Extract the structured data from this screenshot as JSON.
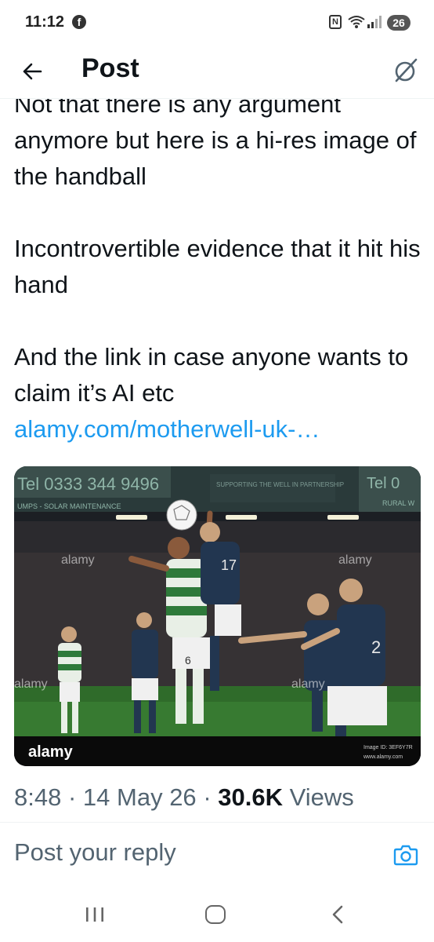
{
  "status_bar": {
    "time": "11:12",
    "fb_icon_letter": "f",
    "nfc_letter": "N",
    "battery": "26",
    "icons": [
      "facebook-icon",
      "nfc-icon",
      "wifi-icon",
      "signal-icon",
      "battery-icon"
    ]
  },
  "header": {
    "title": "Post",
    "back_icon": "arrow-left-icon",
    "grok_icon": "grok-icon"
  },
  "tweet": {
    "lines": [
      "Not that there is any argument anymore but here is a hi-res image of the handball",
      "Incontrovertible evidence that it hit his hand",
      "And the link in case anyone wants to claim it’s AI etc"
    ],
    "link": "alamy.com/motherwell-uk-…",
    "image": {
      "watermark": "alamy",
      "corner_logo": "alamy",
      "image_id": "Image ID: 3EF6Y7R",
      "url": "www.alamy.com",
      "board_text_1": "Tel 0333 344 9496",
      "board_text_2": "SUPPORTING THE WELL IN PARTNERSHIP",
      "board_text_3": "Tel 0",
      "board_text_4": "UMPS - SOLAR MAINTENANCE",
      "board_text_5": "RURAL W"
    }
  },
  "meta": {
    "time": "8:48",
    "date": "14 May 26",
    "views_count": "30.6K",
    "views_label": "Views",
    "separator": "·"
  },
  "reply": {
    "placeholder": "Post your reply",
    "camera_icon": "camera-icon"
  },
  "nav": {
    "icons": [
      "recent-apps-icon",
      "home-icon",
      "back-icon"
    ]
  },
  "colors": {
    "link": "#1d9bf0",
    "secondary_text": "#536471",
    "primary_text": "#0f1419"
  }
}
